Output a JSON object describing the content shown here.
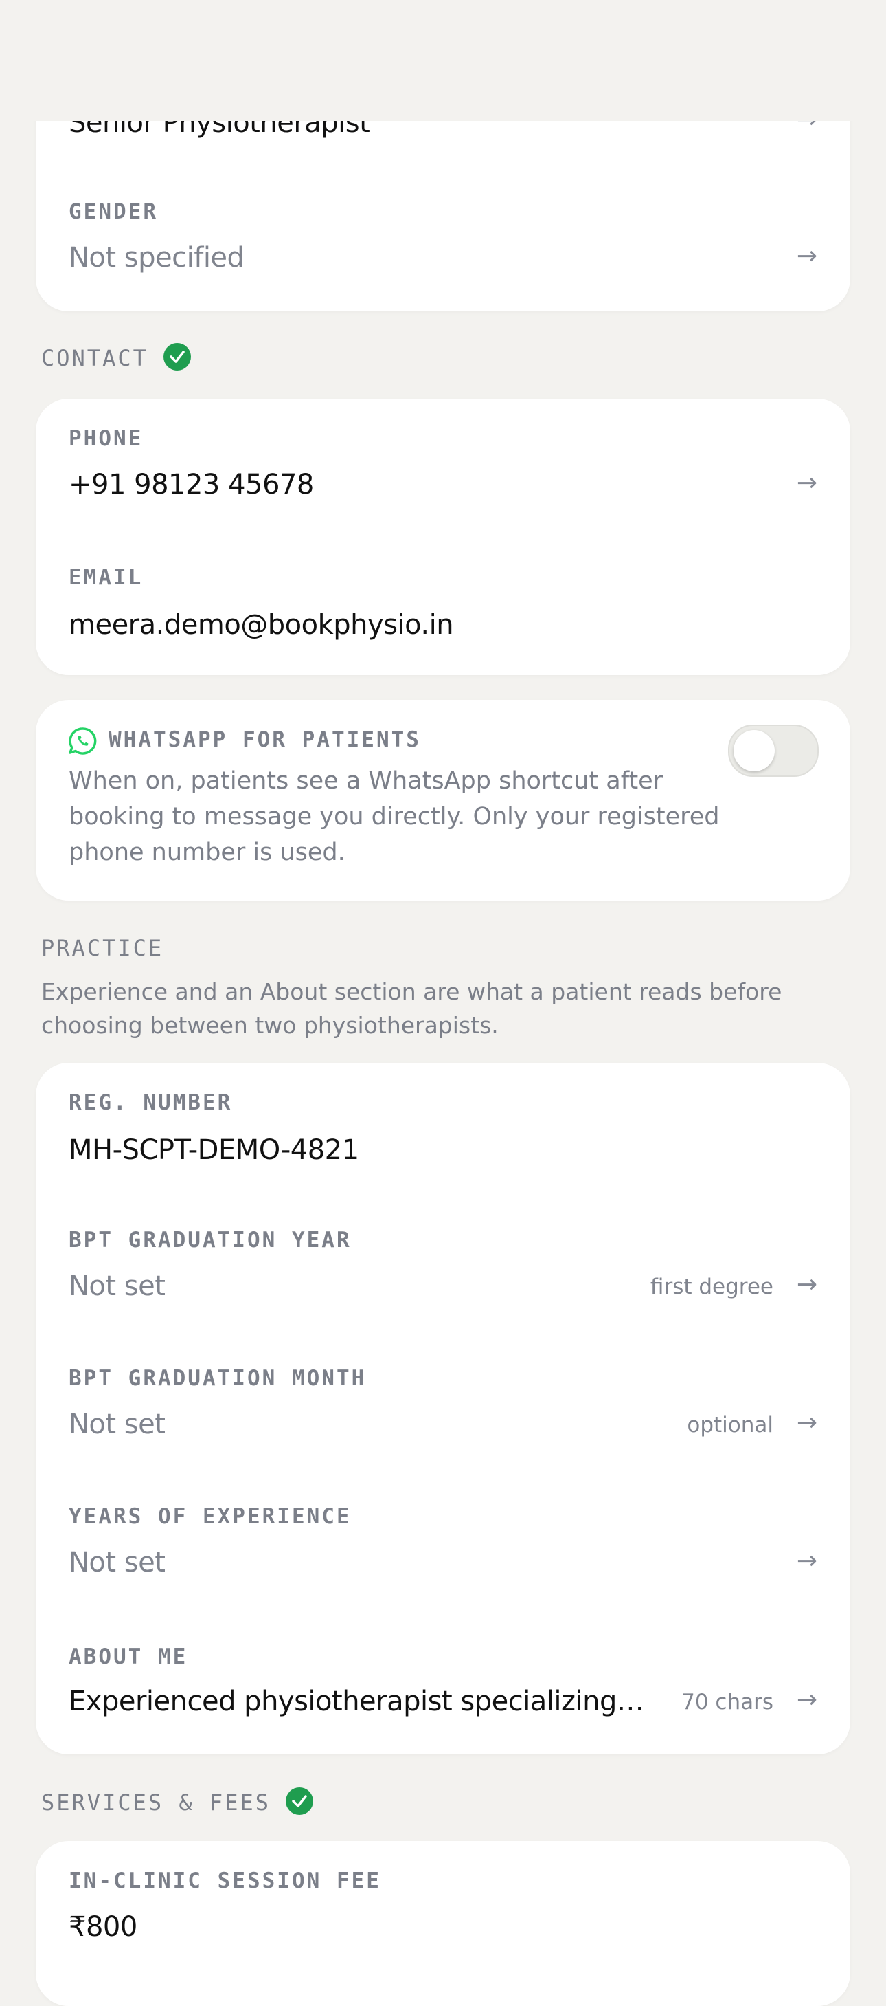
{
  "profile": {
    "title_value": "Senior Physiotherapist",
    "gender_label": "GENDER",
    "gender_value": "Not specified"
  },
  "contact": {
    "section_title": "CONTACT",
    "phone_label": "PHONE",
    "phone_value": "+91 98123 45678",
    "email_label": "EMAIL",
    "email_value": "meera.demo@bookphysio.in"
  },
  "whatsapp": {
    "label": "WHATSAPP FOR PATIENTS",
    "description": "When on, patients see a WhatsApp shortcut after booking to message you directly. Only your registered phone number is used.",
    "enabled": false
  },
  "practice": {
    "section_title": "PRACTICE",
    "description": "Experience and an About section are what a patient reads before choosing between two physiotherapists.",
    "reg_label": "REG. NUMBER",
    "reg_value": "MH-SCPT-DEMO-4821",
    "grad_year_label": "BPT GRADUATION YEAR",
    "grad_year_value": "Not set",
    "grad_year_hint": "first degree",
    "grad_month_label": "BPT GRADUATION MONTH",
    "grad_month_value": "Not set",
    "grad_month_hint": "optional",
    "experience_label": "YEARS OF EXPERIENCE",
    "experience_value": "Not set",
    "about_label": "ABOUT ME",
    "about_value": "Experienced physiotherapist specializing…",
    "about_hint": "70 chars"
  },
  "services": {
    "section_title": "SERVICES & FEES",
    "clinic_fee_label": "IN-CLINIC SESSION FEE",
    "clinic_fee_value": "₹800"
  },
  "icons": {
    "arrow": "arrow-right-icon",
    "check": "check-circle-icon",
    "whatsapp": "whatsapp-icon"
  },
  "colors": {
    "background": "#f3f2ef",
    "card": "#ffffff",
    "success": "#1f9d4f",
    "whatsapp": "#25d366"
  }
}
